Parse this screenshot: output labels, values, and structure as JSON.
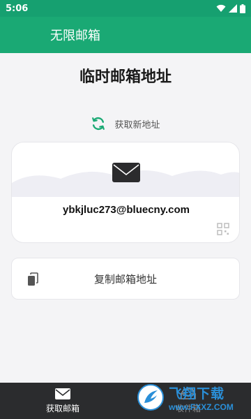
{
  "status_bar": {
    "time": "5:06",
    "icons": [
      "wifi-icon",
      "signal-icon",
      "battery-icon"
    ]
  },
  "app_bar": {
    "title": "无限邮箱"
  },
  "page": {
    "title": "临时邮箱地址",
    "refresh_label": "获取新地址",
    "email": "ybkjluc273@bluecny.com",
    "copy_label": "复制邮箱地址"
  },
  "bottom_nav": {
    "items": [
      {
        "label": "获取邮箱",
        "icon": "mail-icon",
        "active": true
      },
      {
        "label": "收件箱",
        "icon": "inbox-icon",
        "active": false
      }
    ]
  },
  "watermark": {
    "brand": "飞翔下载",
    "url": "www.FXXZ.COM"
  },
  "colors": {
    "primary": "#1aa974",
    "status_bar": "#16a070",
    "bottom_nav_bg": "#2b2c2e",
    "page_bg": "#f4f4f6",
    "watermark": "#2a8fd8"
  }
}
